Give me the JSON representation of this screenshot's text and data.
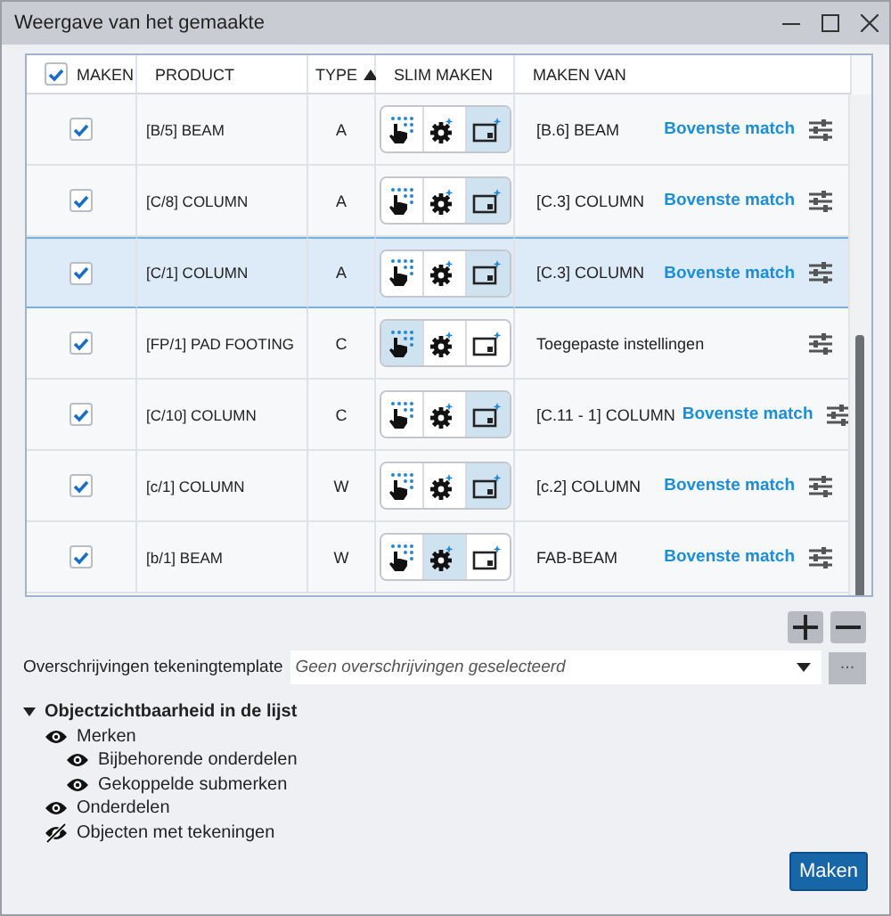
{
  "window": {
    "title": "Weergave van het gemaakte"
  },
  "table": {
    "header_checkbox": {
      "checked": true
    },
    "columns": [
      {
        "label": "MAKEN",
        "sorted": false
      },
      {
        "label": "PRODUCT",
        "sorted": false
      },
      {
        "label": "TYPE",
        "sorted": true
      },
      {
        "label": "SLIM MAKEN",
        "sorted": false
      },
      {
        "label": "MAKEN VAN",
        "sorted": false
      }
    ],
    "rows": [
      {
        "checked": true,
        "product": "[B/5] BEAM",
        "type": "A",
        "modes": [
          {
            "kind": "hand",
            "selected": false
          },
          {
            "kind": "gear",
            "selected": false
          },
          {
            "kind": "sheet",
            "selected": true
          }
        ],
        "source": "[B.6] BEAM",
        "match": "Bovenste match",
        "selected": false
      },
      {
        "checked": true,
        "product": "[C/8] COLUMN",
        "type": "A",
        "modes": [
          {
            "kind": "hand",
            "selected": false
          },
          {
            "kind": "gear",
            "selected": false
          },
          {
            "kind": "sheet",
            "selected": true
          }
        ],
        "source": "[C.3] COLUMN",
        "match": "Bovenste match",
        "selected": false
      },
      {
        "checked": true,
        "product": "[C/1] COLUMN",
        "type": "A",
        "modes": [
          {
            "kind": "hand",
            "selected": false
          },
          {
            "kind": "gear",
            "selected": false
          },
          {
            "kind": "sheet",
            "selected": true
          }
        ],
        "source": "[C.3] COLUMN",
        "match": "Bovenste match",
        "selected": true
      },
      {
        "checked": true,
        "product": "[FP/1] PAD FOOTING",
        "type": "C",
        "modes": [
          {
            "kind": "hand",
            "selected": true
          },
          {
            "kind": "gear",
            "selected": false
          },
          {
            "kind": "sheet",
            "selected": false
          }
        ],
        "source": "Toegepaste instellingen",
        "selected": false
      },
      {
        "checked": true,
        "product": "[C/10] COLUMN",
        "type": "C",
        "modes": [
          {
            "kind": "hand",
            "selected": false
          },
          {
            "kind": "gear",
            "selected": false
          },
          {
            "kind": "sheet",
            "selected": true
          }
        ],
        "source": "[C.11 - 1] COLUMN",
        "match": "Bovenste match",
        "selected": false
      },
      {
        "checked": true,
        "product": "[c/1] COLUMN",
        "type": "W",
        "modes": [
          {
            "kind": "hand",
            "selected": false
          },
          {
            "kind": "gear",
            "selected": false
          },
          {
            "kind": "sheet",
            "selected": true
          }
        ],
        "source": "[c.2] COLUMN",
        "match": "Bovenste match",
        "selected": false
      },
      {
        "checked": true,
        "product": "[b/1] BEAM",
        "type": "W",
        "modes": [
          {
            "kind": "hand",
            "selected": false
          },
          {
            "kind": "gear",
            "selected": true
          },
          {
            "kind": "sheet",
            "selected": false
          }
        ],
        "source": "FAB-BEAM",
        "match": "Bovenste match",
        "selected": false
      }
    ]
  },
  "template": {
    "label": "Overschrijvingen tekeningtemplate",
    "placeholder": "Geen overschrijvingen geselecteerd",
    "browse_button": "..."
  },
  "visibility": {
    "label": "Objectzichtbaarheid in de lijst",
    "expanded": true,
    "children": [
      {
        "label": "Merken",
        "visible": true,
        "children": [
          {
            "label": "Bijbehorende onderdelen",
            "visible": true
          },
          {
            "label": "Gekoppelde submerken",
            "visible": true
          }
        ]
      },
      {
        "label": "Onderdelen",
        "visible": true
      },
      {
        "label": "Objecten met tekeningen",
        "visible": false
      }
    ]
  },
  "buttons": [
    {
      "label": "Maken"
    }
  ]
}
